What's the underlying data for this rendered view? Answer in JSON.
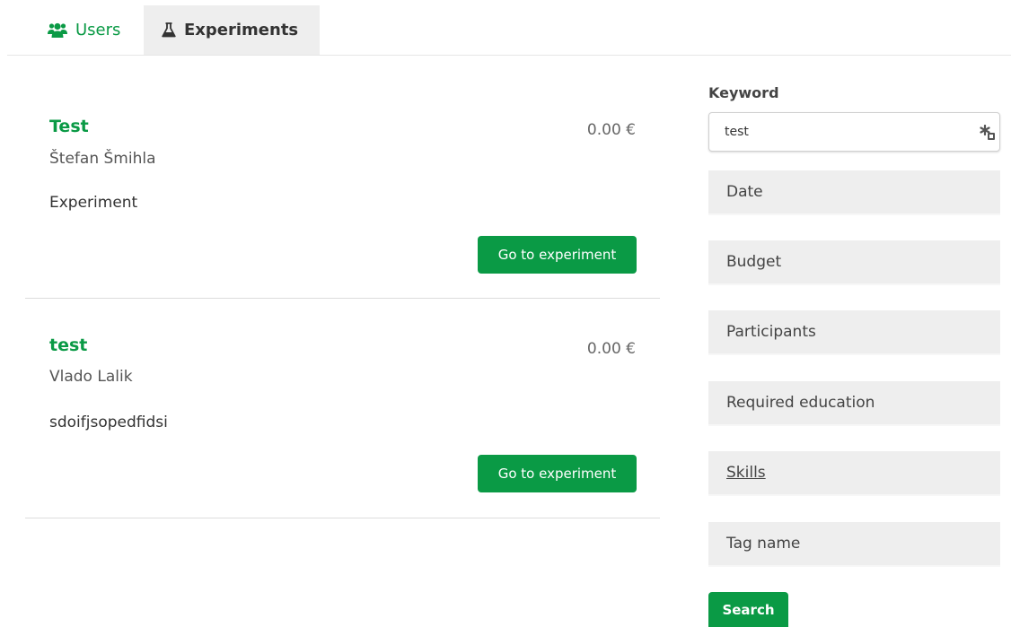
{
  "tabs": {
    "users": "Users",
    "experiments": "Experiments"
  },
  "experiments": [
    {
      "title": "Test",
      "author": "Štefan Šmihla",
      "description": "Experiment",
      "price": "0.00 €",
      "button": "Go to experiment"
    },
    {
      "title": "test",
      "author": "Vlado Lalik",
      "description": "sdoifjsopedfidsi",
      "price": "0.00 €",
      "button": "Go to experiment"
    }
  ],
  "filters": {
    "keyword_label": "Keyword",
    "keyword_value": "test",
    "items": [
      "Date",
      "Budget",
      "Participants",
      "Required education",
      "Skills",
      "Tag name"
    ],
    "search_label": "Search"
  },
  "colors": {
    "accent": "#0a9a45",
    "tab_active_bg": "#eeeeee",
    "filter_bg": "#eeeeee"
  },
  "icons": {
    "users_tab": "users-icon",
    "experiments_tab": "flask-icon",
    "keyword_clear": "clear-icon"
  }
}
